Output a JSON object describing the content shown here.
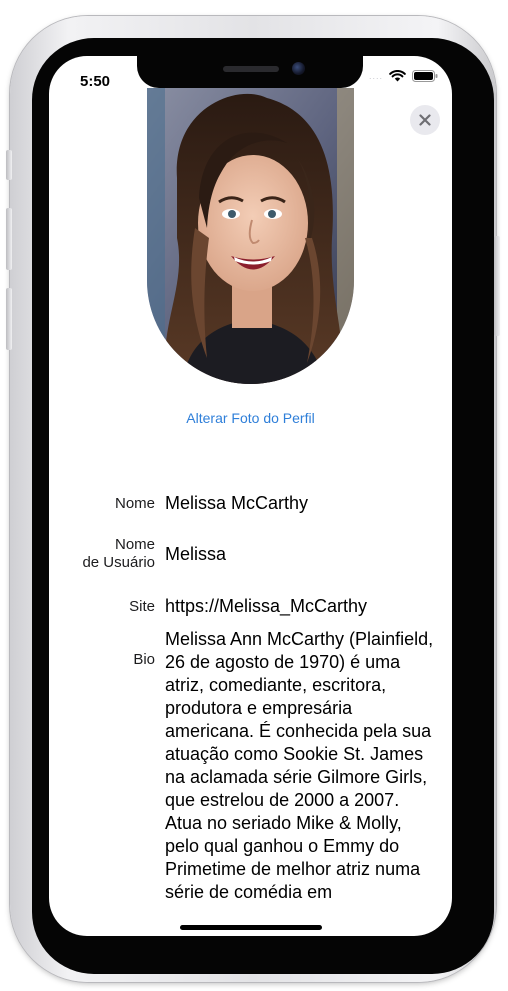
{
  "status_bar": {
    "time": "5:50",
    "signal": "....",
    "icons": [
      "wifi-icon",
      "battery-icon"
    ]
  },
  "profile": {
    "change_photo_label": "Alterar Foto do Perfil",
    "close_icon": "close-icon"
  },
  "fields": {
    "name": {
      "label": "Nome",
      "value": "Melissa McCarthy"
    },
    "username": {
      "label_line1": "Nome",
      "label_line2": "de Usuário",
      "value": "Melissa"
    },
    "site": {
      "label": "Site",
      "value": "https://Melissa_McCarthy"
    },
    "bio": {
      "label": "Bio",
      "value": "Melissa Ann McCarthy (Plainfield, 26 de agosto de 1970) é uma atriz, comediante, escritora, produtora e empresária americana. É conhecida pela sua atuação como Sookie St. James na aclamada série Gilmore Girls, que estrelou de 2000 a 2007. Atua no seriado Mike & Molly, pelo qual ganhou o Emmy do Primetime de melhor atriz numa série de comédia em"
    }
  },
  "colors": {
    "link": "#2f7fd9",
    "close_bg": "#e9e9ee"
  }
}
